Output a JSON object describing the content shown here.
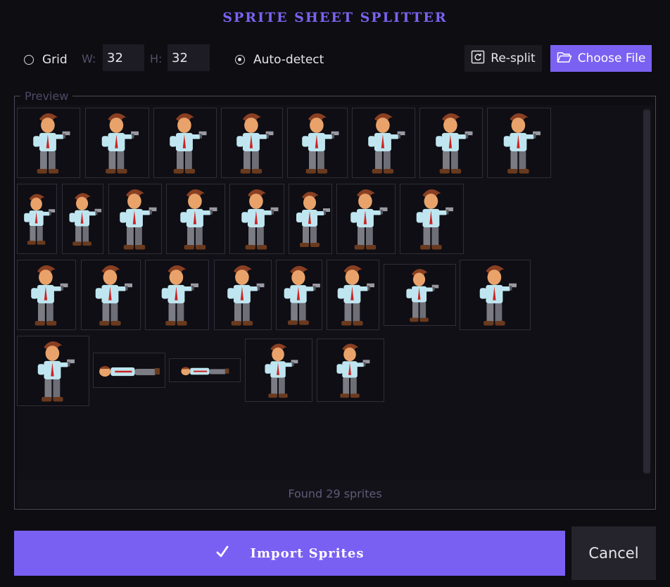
{
  "title": "SPRITE SHEET SPLITTER",
  "options": {
    "grid_label": "Grid",
    "w_label": "W:",
    "w_value": "32",
    "h_label": "H:",
    "h_value": "32",
    "auto_label": "Auto-detect",
    "selected_mode": "auto-detect"
  },
  "toolbar": {
    "resplit_label": "Re-split",
    "choose_label": "Choose File",
    "resplit_icon": "refresh-icon",
    "choose_icon": "folder-open-icon"
  },
  "preview": {
    "legend": "Preview",
    "status": "Found 29 sprites",
    "sprite_count": 29
  },
  "footer": {
    "import_icon": "checkmark-icon",
    "import_label": "Import Sprites",
    "cancel_label": "Cancel"
  },
  "colors": {
    "accent": "#7b61f2",
    "background": "#0e0d12",
    "panel": "#111016",
    "cell_border": "#2f2d39"
  }
}
